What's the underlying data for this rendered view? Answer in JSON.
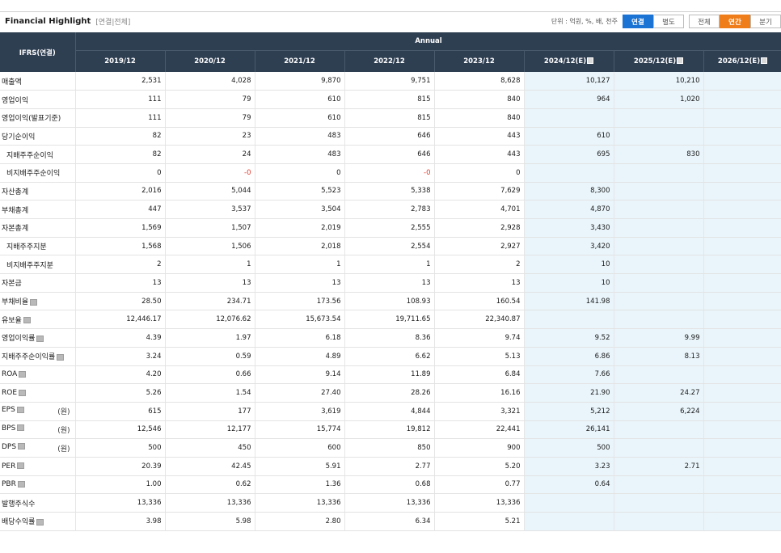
{
  "header": {
    "title": "Financial Highlight",
    "subtitle": "[연결|전체]",
    "unit_text": "단위 : 억원, %, 배, 천주",
    "btn_consolidated": "연결",
    "btn_separate": "별도",
    "btn_all": "전체",
    "btn_annual": "연간",
    "btn_quarter": "분기"
  },
  "table": {
    "ifrs_label": "IFRS(연결)",
    "group_label": "Annual",
    "columns": [
      "2019/12",
      "2020/12",
      "2021/12",
      "2022/12",
      "2023/12",
      "2024/12(E)",
      "2025/12(E)",
      "2026/12(E)"
    ],
    "rows": [
      {
        "label": "매출액",
        "indent": false,
        "info": false,
        "unit": "",
        "values": [
          "2,531",
          "4,028",
          "9,870",
          "9,751",
          "8,628",
          "10,127",
          "10,210",
          ""
        ]
      },
      {
        "label": "영업이익",
        "indent": false,
        "info": false,
        "unit": "",
        "values": [
          "111",
          "79",
          "610",
          "815",
          "840",
          "964",
          "1,020",
          ""
        ]
      },
      {
        "label": "영업이익(발표기준)",
        "indent": false,
        "info": false,
        "unit": "",
        "values": [
          "111",
          "79",
          "610",
          "815",
          "840",
          "",
          "",
          ""
        ]
      },
      {
        "label": "당기순이익",
        "indent": false,
        "info": false,
        "unit": "",
        "values": [
          "82",
          "23",
          "483",
          "646",
          "443",
          "610",
          "",
          ""
        ]
      },
      {
        "label": "지배주주순이익",
        "indent": true,
        "info": false,
        "unit": "",
        "values": [
          "82",
          "24",
          "483",
          "646",
          "443",
          "695",
          "830",
          ""
        ]
      },
      {
        "label": "비지배주주순이익",
        "indent": true,
        "info": false,
        "unit": "",
        "values": [
          "0",
          "-0",
          "0",
          "-0",
          "0",
          "",
          "",
          ""
        ]
      },
      {
        "label": "자산총계",
        "indent": false,
        "info": false,
        "unit": "",
        "values": [
          "2,016",
          "5,044",
          "5,523",
          "5,338",
          "7,629",
          "8,300",
          "",
          ""
        ]
      },
      {
        "label": "부채총계",
        "indent": false,
        "info": false,
        "unit": "",
        "values": [
          "447",
          "3,537",
          "3,504",
          "2,783",
          "4,701",
          "4,870",
          "",
          ""
        ]
      },
      {
        "label": "자본총계",
        "indent": false,
        "info": false,
        "unit": "",
        "values": [
          "1,569",
          "1,507",
          "2,019",
          "2,555",
          "2,928",
          "3,430",
          "",
          ""
        ]
      },
      {
        "label": "지배주주지분",
        "indent": true,
        "info": false,
        "unit": "",
        "values": [
          "1,568",
          "1,506",
          "2,018",
          "2,554",
          "2,927",
          "3,420",
          "",
          ""
        ]
      },
      {
        "label": "비지배주주지분",
        "indent": true,
        "info": false,
        "unit": "",
        "values": [
          "2",
          "1",
          "1",
          "1",
          "2",
          "10",
          "",
          ""
        ]
      },
      {
        "label": "자본금",
        "indent": false,
        "info": false,
        "unit": "",
        "values": [
          "13",
          "13",
          "13",
          "13",
          "13",
          "10",
          "",
          ""
        ]
      },
      {
        "label": "부채비율",
        "indent": false,
        "info": true,
        "unit": "",
        "values": [
          "28.50",
          "234.71",
          "173.56",
          "108.93",
          "160.54",
          "141.98",
          "",
          ""
        ]
      },
      {
        "label": "유보율",
        "indent": false,
        "info": true,
        "unit": "",
        "values": [
          "12,446.17",
          "12,076.62",
          "15,673.54",
          "19,711.65",
          "22,340.87",
          "",
          "",
          ""
        ]
      },
      {
        "label": "영업이익률",
        "indent": false,
        "info": true,
        "unit": "",
        "values": [
          "4.39",
          "1.97",
          "6.18",
          "8.36",
          "9.74",
          "9.52",
          "9.99",
          ""
        ]
      },
      {
        "label": "지배주주순이익률",
        "indent": false,
        "info": true,
        "unit": "",
        "values": [
          "3.24",
          "0.59",
          "4.89",
          "6.62",
          "5.13",
          "6.86",
          "8.13",
          ""
        ]
      },
      {
        "label": "ROA",
        "indent": false,
        "info": true,
        "unit": "",
        "values": [
          "4.20",
          "0.66",
          "9.14",
          "11.89",
          "6.84",
          "7.66",
          "",
          ""
        ]
      },
      {
        "label": "ROE",
        "indent": false,
        "info": true,
        "unit": "",
        "values": [
          "5.26",
          "1.54",
          "27.40",
          "28.26",
          "16.16",
          "21.90",
          "24.27",
          ""
        ]
      },
      {
        "label": "EPS",
        "indent": false,
        "info": true,
        "unit": "(원)",
        "values": [
          "615",
          "177",
          "3,619",
          "4,844",
          "3,321",
          "5,212",
          "6,224",
          ""
        ]
      },
      {
        "label": "BPS",
        "indent": false,
        "info": true,
        "unit": "(원)",
        "values": [
          "12,546",
          "12,177",
          "15,774",
          "19,812",
          "22,441",
          "26,141",
          "",
          ""
        ]
      },
      {
        "label": "DPS",
        "indent": false,
        "info": true,
        "unit": "(원)",
        "values": [
          "500",
          "450",
          "600",
          "850",
          "900",
          "500",
          "",
          ""
        ]
      },
      {
        "label": "PER",
        "indent": false,
        "info": true,
        "unit": "",
        "values": [
          "20.39",
          "42.45",
          "5.91",
          "2.77",
          "5.20",
          "3.23",
          "2.71",
          ""
        ]
      },
      {
        "label": "PBR",
        "indent": false,
        "info": true,
        "unit": "",
        "values": [
          "1.00",
          "0.62",
          "1.36",
          "0.68",
          "0.77",
          "0.64",
          "",
          ""
        ]
      },
      {
        "label": "발행주식수",
        "indent": false,
        "info": false,
        "unit": "",
        "values": [
          "13,336",
          "13,336",
          "13,336",
          "13,336",
          "13,336",
          "",
          "",
          ""
        ]
      },
      {
        "label": "배당수익률",
        "indent": false,
        "info": true,
        "unit": "",
        "values": [
          "3.98",
          "5.98",
          "2.80",
          "6.34",
          "5.21",
          "",
          "",
          ""
        ]
      }
    ]
  }
}
